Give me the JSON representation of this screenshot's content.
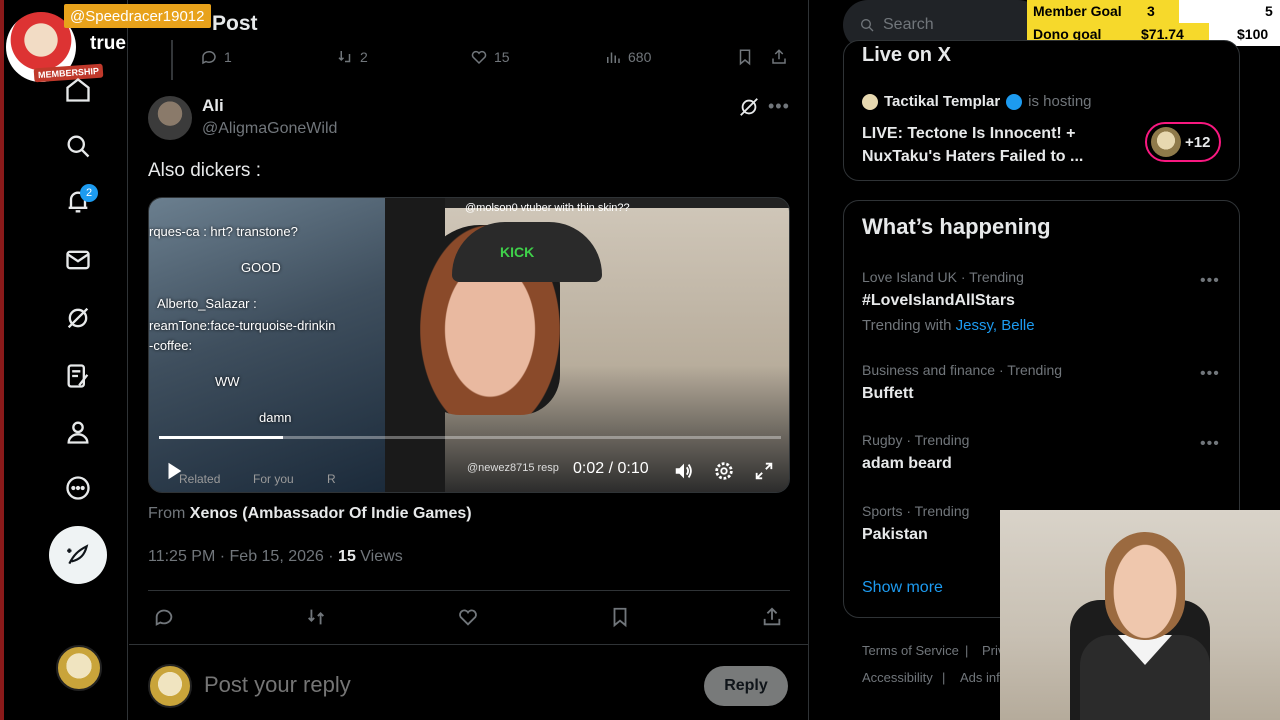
{
  "overlay": {
    "user_tag": "@Speedracer19012",
    "true_label": "true",
    "membership": "MEMBERSHIP"
  },
  "nav": {
    "notification_count": "2",
    "items": [
      "home-icon",
      "search-icon",
      "bell-icon",
      "mail-icon",
      "grok-icon",
      "notes-icon",
      "profile-icon",
      "more-icon"
    ]
  },
  "header": {
    "title": "Post"
  },
  "prev_post_stats": {
    "replies": "1",
    "reposts": "2",
    "likes": "15",
    "views": "680"
  },
  "post": {
    "author_name": "Ali",
    "author_handle": "@AligmaGoneWild",
    "text": "Also dickers :",
    "video": {
      "chat_lines": [
        "rques-ca : hrt? transtone?",
        "GOOD",
        "Alberto_Salazar :",
        "reamTone:face-turquoise-drinkin",
        "-coffee:",
        "WW",
        "damn"
      ],
      "top_text": "@molson0  vtuber with thin skin??",
      "bottom_right_text": "@newez8715  resp",
      "cap_text": "KICK",
      "time": "0:02 / 0:10",
      "progress": 0.2,
      "bottom_tabs": [
        "Related",
        "For you",
        "R"
      ]
    },
    "from_prefix": "From",
    "from_source": "Xenos (Ambassador Of Indie Games)",
    "timestamp": "11:25 PM · Feb 15, 2026 ·",
    "views_count": "15",
    "views_label": "Views"
  },
  "reply": {
    "placeholder": "Post your reply",
    "button": "Reply"
  },
  "sidebar": {
    "search_placeholder": "Search",
    "goals": {
      "member_label": "Member Goal",
      "member_current": "3",
      "member_target": "5",
      "member_progress": 0.6,
      "dono_label": "Dono goal",
      "dono_current": "$71.74",
      "dono_target": "$100",
      "dono_progress": 0.72
    },
    "live": {
      "title": "Live on X",
      "host_name": "Tactikal Templar",
      "host_suffix": "is hosting",
      "text": "LIVE: Tectone Is Innocent! + NuxTaku's Haters Failed to ...",
      "extra_count": "+12"
    },
    "happening": {
      "title": "What’s happening",
      "trends": [
        {
          "meta": "Love Island UK · Trending",
          "name": "#LoveIslandAllStars",
          "with_label": "Trending with",
          "with_links": "Jessy, Belle"
        },
        {
          "meta": "Business and finance · Trending",
          "name": "Buffett"
        },
        {
          "meta": "Rugby · Trending",
          "name": "adam beard"
        },
        {
          "meta": "Sports · Trending",
          "name": "Pakistan"
        }
      ],
      "show_more": "Show more"
    },
    "footer": {
      "terms": "Terms of Service",
      "privacy": "Priv",
      "accessibility": "Accessibility",
      "ads": "Ads inf"
    }
  },
  "colors": {
    "accent": "#1d9bf0",
    "live_border": "#f91880",
    "goal_fill": "#f6d92b",
    "user_tag": "#e8a21b"
  }
}
